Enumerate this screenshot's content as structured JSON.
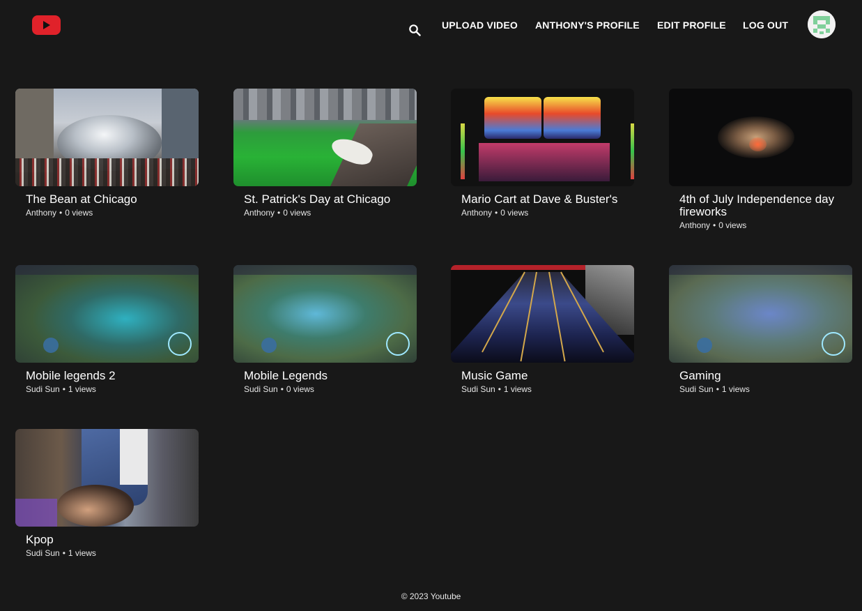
{
  "header": {
    "logo_icon": "youtube-logo-icon",
    "search_icon": "search-icon",
    "nav": {
      "upload": "UPLOAD VIDEO",
      "profile": "ANTHONY'S PROFILE",
      "edit": "EDIT PROFILE",
      "logout": "LOG OUT"
    },
    "avatar_icon": "avatar-icon"
  },
  "videos": [
    {
      "title": "The Bean at Chicago",
      "author": "Anthony",
      "views": "0 views"
    },
    {
      "title": "St. Patrick's Day at Chicago",
      "author": "Anthony",
      "views": "0 views"
    },
    {
      "title": "Mario Cart at Dave & Buster's",
      "author": "Anthony",
      "views": "0 views"
    },
    {
      "title": "4th of July Independence day fireworks",
      "author": "Anthony",
      "views": "0 views"
    },
    {
      "title": "Mobile legends 2",
      "author": "Sudi Sun",
      "views": "1 views"
    },
    {
      "title": "Mobile Legends",
      "author": "Sudi Sun",
      "views": "0 views"
    },
    {
      "title": "Music Game",
      "author": "Sudi Sun",
      "views": "1 views"
    },
    {
      "title": "Gaming",
      "author": "Sudi Sun",
      "views": "1 views"
    },
    {
      "title": "Kpop",
      "author": "Sudi Sun",
      "views": "1 views"
    }
  ],
  "footer": {
    "text": "© 2023 Youtube"
  },
  "colors": {
    "background": "#181818",
    "accent": "#e0222a"
  }
}
